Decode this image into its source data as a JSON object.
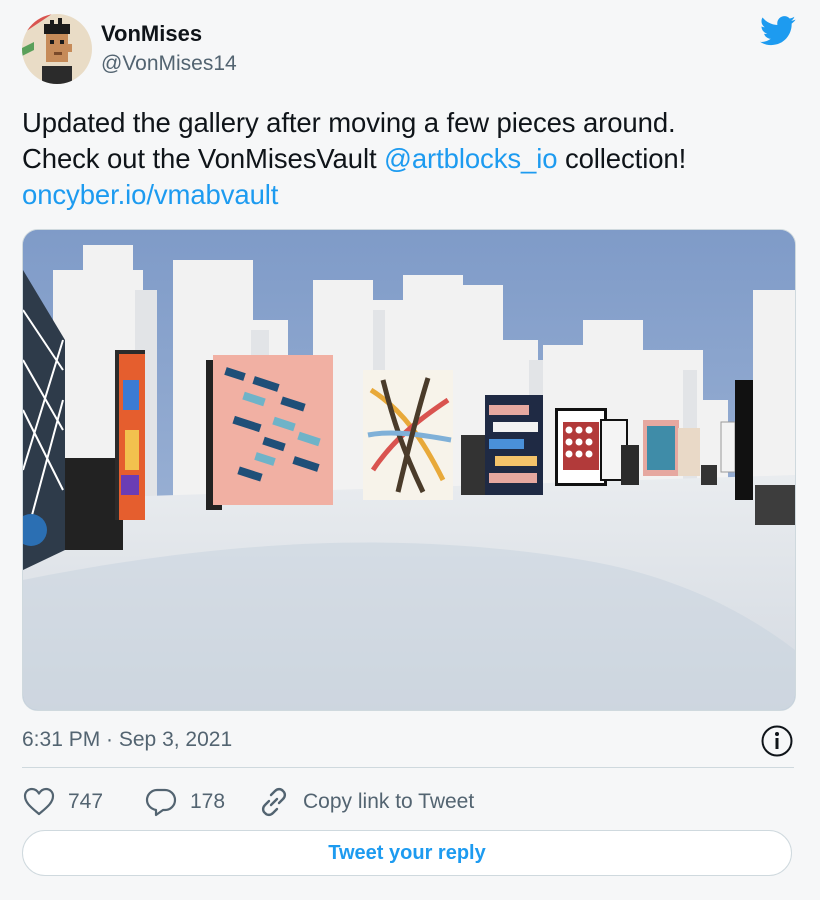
{
  "author": {
    "display_name": "VonMises",
    "handle": "@VonMises14"
  },
  "tweet": {
    "line1": "Updated the gallery after moving a few pieces around.",
    "line2_prefix": "Check out the VonMisesVault ",
    "mention": "@artblocks_io",
    "line2_suffix": " collection!",
    "url": "oncyber.io/vmabvault"
  },
  "timestamp": "6:31 PM · Sep 3, 2021",
  "actions": {
    "likes": "747",
    "replies": "178",
    "copy_link_label": "Copy link to Tweet"
  },
  "reply_button_label": "Tweet your reply",
  "icons": {
    "brand": "twitter-bird-icon",
    "info": "info-icon",
    "like": "heart-icon",
    "reply": "reply-bubble-icon",
    "copy": "link-icon"
  },
  "colors": {
    "accent": "#1d9bf0",
    "text": "#0f1419",
    "muted": "#536471",
    "border": "#cfd9de",
    "background": "#f6f7f8"
  }
}
